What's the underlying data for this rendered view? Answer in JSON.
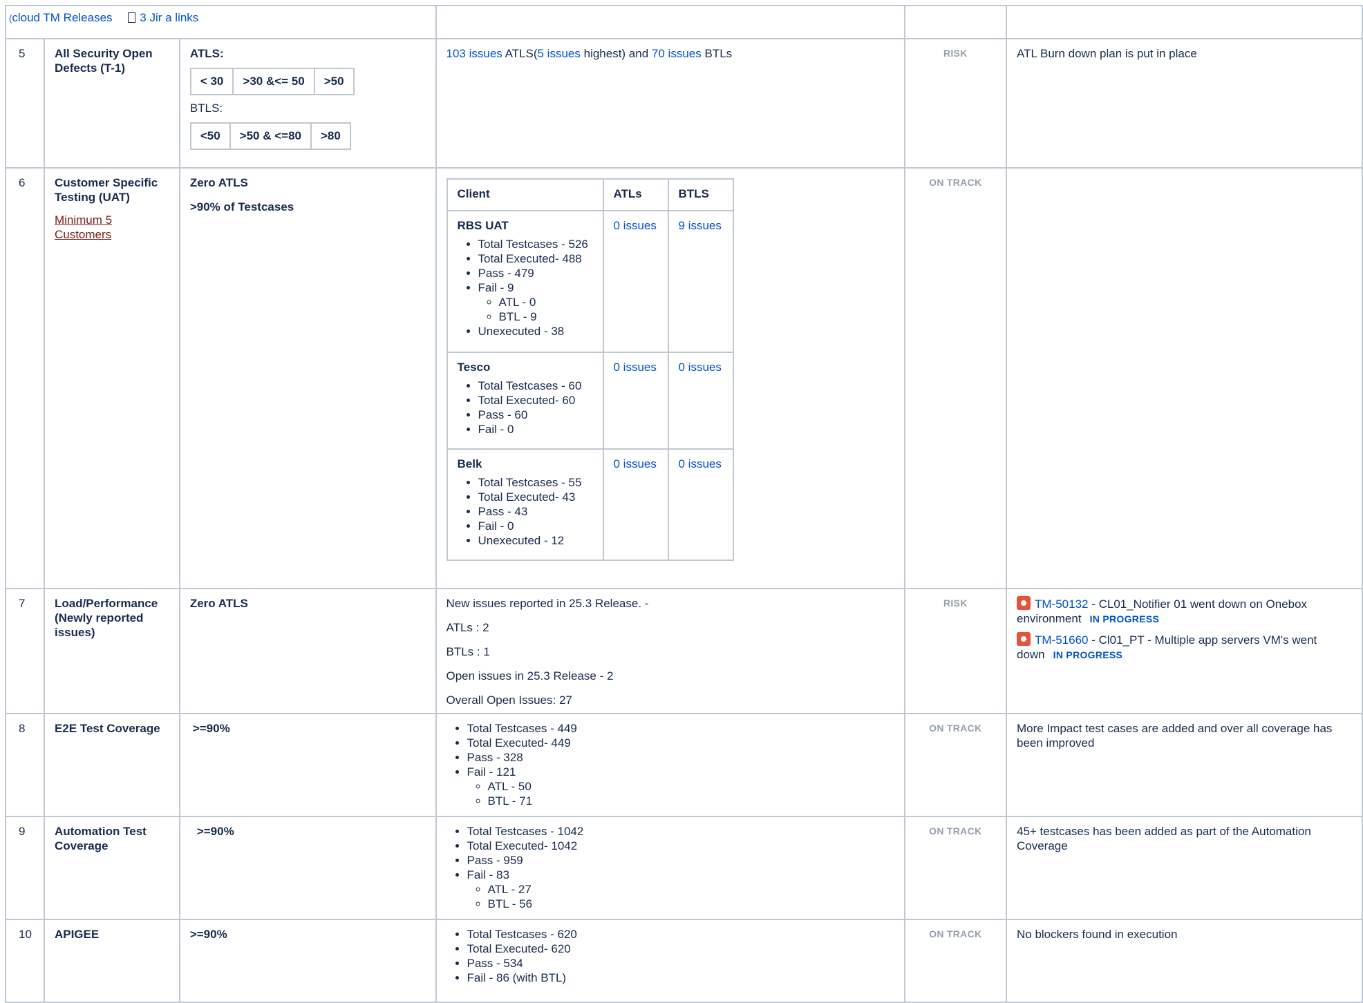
{
  "top_links": {
    "cut_prefix": "(",
    "releases_link": "cloud TM Releases",
    "jira_links": "3 Jir  a links"
  },
  "rows": [
    {
      "num": "5",
      "title": "All Security Open Defects (T-1)",
      "target_label1": "ATLS:",
      "atls_thresholds": [
        "< 30",
        ">30 &<= 50",
        ">50"
      ],
      "target_label2": "BTLS:",
      "btls_thresholds": [
        "<50",
        ">50 & <=80",
        ">80"
      ],
      "status": "RISK",
      "comment": "ATL Burn down plan is put in place",
      "current": {
        "issues_atls": "103 issues",
        "text1": "ATLS(",
        "issues_highest": "5 issues",
        "text2": "highest)  and",
        "issues_btls": "70 issues",
        "text3": "BTLs"
      }
    },
    {
      "num": "6",
      "title": "Customer Specific Testing (UAT)",
      "title_link": "Minimum 5 Customers",
      "target_line1": "Zero ATLS",
      "target_line2": ">90% of Testcases",
      "status": "ON TRACK",
      "table": {
        "headers": [
          "Client",
          "ATLs",
          "BTLS"
        ],
        "clients": [
          {
            "name": "RBS UAT",
            "atls": "0 issues",
            "btls": "9 issues",
            "items": [
              "Total Testcases - 526",
              "Total Executed- 488",
              "Pass - 479",
              "Fail - 9"
            ],
            "sub_items": [
              "ATL - 0",
              "BTL - 9"
            ],
            "after_items": [
              "Unexecuted - 38"
            ]
          },
          {
            "name": "Tesco",
            "atls": "0 issues",
            "btls": "0 issues",
            "items": [
              "Total Testcases - 60",
              "Total Executed- 60",
              "Pass - 60",
              "Fail - 0"
            ]
          },
          {
            "name": "Belk",
            "atls": "0 issues",
            "btls": "0 issues",
            "items": [
              "Total Testcases - 55",
              "Total Executed- 43",
              "Pass - 43",
              "Fail - 0",
              "Unexecuted - 12"
            ]
          }
        ]
      }
    },
    {
      "num": "7",
      "title": "Load/Performance (Newly reported issues)",
      "target": "Zero ATLS",
      "status": "RISK",
      "lines": [
        "New issues reported in 25.3 Release. -",
        "ATLs : 2",
        "BTLs : 1",
        "Open issues in 25.3 Release - 2",
        "Overall Open Issues:  27"
      ],
      "issues": [
        {
          "key": "TM-50132",
          "summary": " - CL01_Notifier 01 went down on Onebox environment",
          "status": "IN PROGRESS"
        },
        {
          "key": "TM-51660",
          "summary": " - Cl01_PT - Multiple app servers VM's went down",
          "status": "IN PROGRESS"
        }
      ]
    },
    {
      "num": "8",
      "title": "E2E Test Coverage",
      "target": ">=90%",
      "status": "ON TRACK",
      "comment": "More Impact test cases are added and over all coverage has been improved",
      "items": [
        "Total Testcases - 449",
        "Total Executed-  449",
        "Pass - 328",
        "Fail - 121"
      ],
      "sub_items": [
        "ATL - 50",
        "BTL - 71"
      ]
    },
    {
      "num": "9",
      "title": "Automation Test Coverage",
      "target": ">=90%",
      "status": "ON TRACK",
      "comment": "45+ testcases has been added as part of the Automation Coverage",
      "items": [
        "Total Testcases - 1042",
        "Total Executed- 1042",
        "Pass - 959",
        "Fail - 83"
      ],
      "sub_items": [
        "ATL - 27",
        "BTL - 56"
      ]
    },
    {
      "num": "10",
      "title": "APIGEE",
      "target": ">=90%",
      "status": "ON TRACK",
      "comment": "No blockers found in execution",
      "items": [
        "Total Testcases - 620",
        "Total Executed- 620",
        "Pass - 534",
        "Fail - 86 (with BTL)"
      ]
    }
  ]
}
